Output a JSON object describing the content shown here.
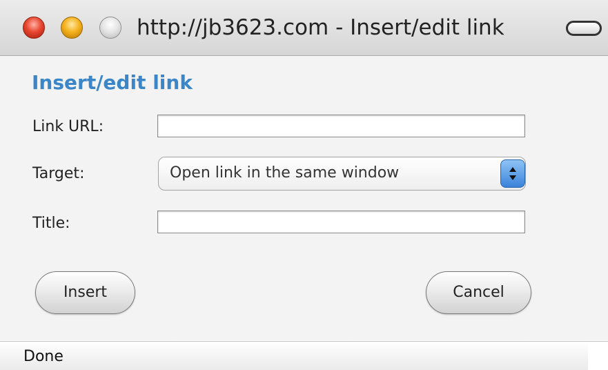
{
  "window": {
    "title": "http://jb3623.com - Insert/edit link"
  },
  "dialog": {
    "heading": "Insert/edit link",
    "link_url": {
      "label": "Link URL:",
      "value": ""
    },
    "target": {
      "label": "Target:",
      "selected": "Open link in the same window"
    },
    "title": {
      "label": "Title:",
      "value": ""
    },
    "insert_label": "Insert",
    "cancel_label": "Cancel"
  },
  "status": {
    "text": "Done"
  },
  "colors": {
    "heading": "#3a86c8",
    "select_arrow": "#3a82d9"
  }
}
